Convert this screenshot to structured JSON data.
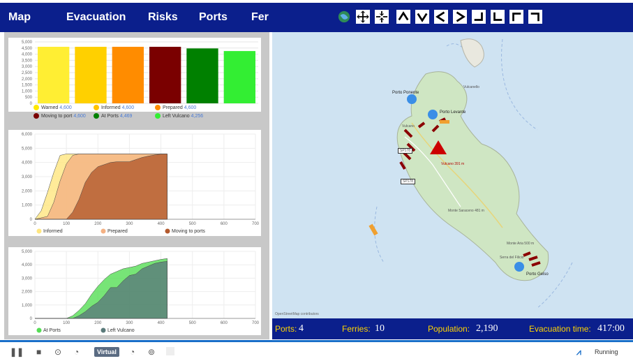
{
  "menu": {
    "items": [
      "Map",
      "Evacuation",
      "Risks",
      "Ports",
      "Ferries"
    ]
  },
  "nav_icons": [
    "globe-icon",
    "zoom-in-icon",
    "zoom-out-icon",
    "pan-up-icon",
    "pan-down-icon",
    "pan-left-icon",
    "pan-right-icon",
    "pan-down-right-icon",
    "pan-down-left-icon",
    "pan-up-left-icon",
    "pan-up-right-icon"
  ],
  "colors": {
    "nav_bg": "#0b1f8c",
    "status_label": "#ffd400",
    "value_text": "#4a7bd6"
  },
  "summary": {
    "legend": [
      {
        "label": "Warned",
        "value": "4,600",
        "color": "#ffe800"
      },
      {
        "label": "Informed",
        "value": "4,600",
        "color": "#ffc400"
      },
      {
        "label": "Prepared",
        "value": "4,600",
        "color": "#ff8c00"
      },
      {
        "label": "Moving to port",
        "value": "4,600",
        "color": "#7a0000"
      },
      {
        "label": "At Ports",
        "value": "4,469",
        "color": "#008000"
      },
      {
        "label": "Left Vulcano",
        "value": "4,256",
        "color": "#33ee33"
      }
    ]
  },
  "chart_data": [
    {
      "type": "bar",
      "categories": [
        "Warned",
        "Informed",
        "Prepared",
        "Moving to port",
        "At Ports",
        "Left Vulcano"
      ],
      "values": [
        4600,
        4600,
        4600,
        4600,
        4469,
        4256
      ],
      "colors": [
        "#ffee33",
        "#ffd000",
        "#ff8c00",
        "#7a0000",
        "#008000",
        "#33ee33"
      ],
      "yticks": [
        "0",
        "500",
        "1,000",
        "1,500",
        "2,000",
        "2,500",
        "3,000",
        "3,500",
        "4,000",
        "4,500",
        "5,000"
      ],
      "ylim": [
        0,
        5000
      ],
      "grid": true
    },
    {
      "type": "area",
      "series": [
        {
          "name": "Informed",
          "color": "#ffe680",
          "x": [
            0,
            20,
            40,
            60,
            80,
            100,
            420
          ],
          "y": [
            0,
            600,
            1900,
            3300,
            4500,
            4600,
            4600
          ]
        },
        {
          "name": "Prepared",
          "color": "#f4b183",
          "x": [
            0,
            40,
            60,
            80,
            100,
            120,
            140,
            420
          ],
          "y": [
            0,
            200,
            1200,
            2700,
            3900,
            4500,
            4600,
            4600
          ]
        },
        {
          "name": "Moving to ports",
          "color": "#b35a2e",
          "x": [
            0,
            100,
            120,
            140,
            160,
            180,
            200,
            240,
            260,
            300,
            320,
            340,
            360,
            380,
            400,
            420
          ],
          "y": [
            0,
            0,
            500,
            1400,
            2600,
            3300,
            3700,
            4000,
            4050,
            4050,
            4200,
            4350,
            4450,
            4530,
            4590,
            4600
          ]
        }
      ],
      "xticks": [
        "0",
        "100",
        "200",
        "300",
        "400",
        "500",
        "600",
        "700"
      ],
      "yticks": [
        "0",
        "1,000",
        "2,000",
        "3,000",
        "4,000",
        "5,000",
        "6,000"
      ],
      "xlim": [
        0,
        700
      ],
      "ylim": [
        0,
        6000
      ]
    },
    {
      "type": "area",
      "series": [
        {
          "name": "At Ports",
          "color": "#55dd55",
          "x": [
            0,
            100,
            120,
            140,
            160,
            180,
            200,
            220,
            240,
            260,
            280,
            300,
            320,
            340,
            360,
            380,
            400,
            420
          ],
          "y": [
            0,
            0,
            200,
            600,
            1100,
            1800,
            2400,
            2900,
            3300,
            3500,
            3700,
            3800,
            3900,
            4100,
            4200,
            4300,
            4400,
            4469
          ]
        },
        {
          "name": "Left Vulcano",
          "color": "#5a7a7a",
          "x": [
            0,
            120,
            140,
            160,
            180,
            200,
            220,
            240,
            260,
            280,
            300,
            320,
            340,
            360,
            380,
            400,
            420
          ],
          "y": [
            0,
            0,
            200,
            500,
            900,
            1200,
            1700,
            2300,
            2300,
            2800,
            3200,
            3300,
            3700,
            3900,
            4100,
            4200,
            4256
          ]
        }
      ],
      "xticks": [
        "0",
        "100",
        "200",
        "300",
        "400",
        "500",
        "600",
        "700"
      ],
      "yticks": [
        "0",
        "1,000",
        "2,000",
        "3,000",
        "4,000",
        "5,000"
      ],
      "xlim": [
        0,
        700
      ],
      "ylim": [
        0,
        5000
      ]
    }
  ],
  "map": {
    "attribution": "OpenStreetMap contributors",
    "ports": [
      {
        "label": "Porto Ponente"
      },
      {
        "label": "Porto Levante"
      },
      {
        "label": "Porto Gelso"
      }
    ],
    "places": [
      "Vulcano",
      "Monte Saraceno 481 m",
      "Monte Aria 500 m",
      "SP178",
      "SP178",
      "Vulcanello",
      "Vulcano 391 m",
      "Serra del Filicio"
    ]
  },
  "status": {
    "ports_label": "Ports:",
    "ports_value": "4",
    "ferries_label": "Ferries:",
    "ferries_value": "10",
    "population_label": "Population:",
    "population_value": "2,190",
    "evac_label": "Evacuation time:",
    "evac_value": "417:00"
  },
  "playback": {
    "virtual_label": "Virtual",
    "state_label": "Running"
  }
}
